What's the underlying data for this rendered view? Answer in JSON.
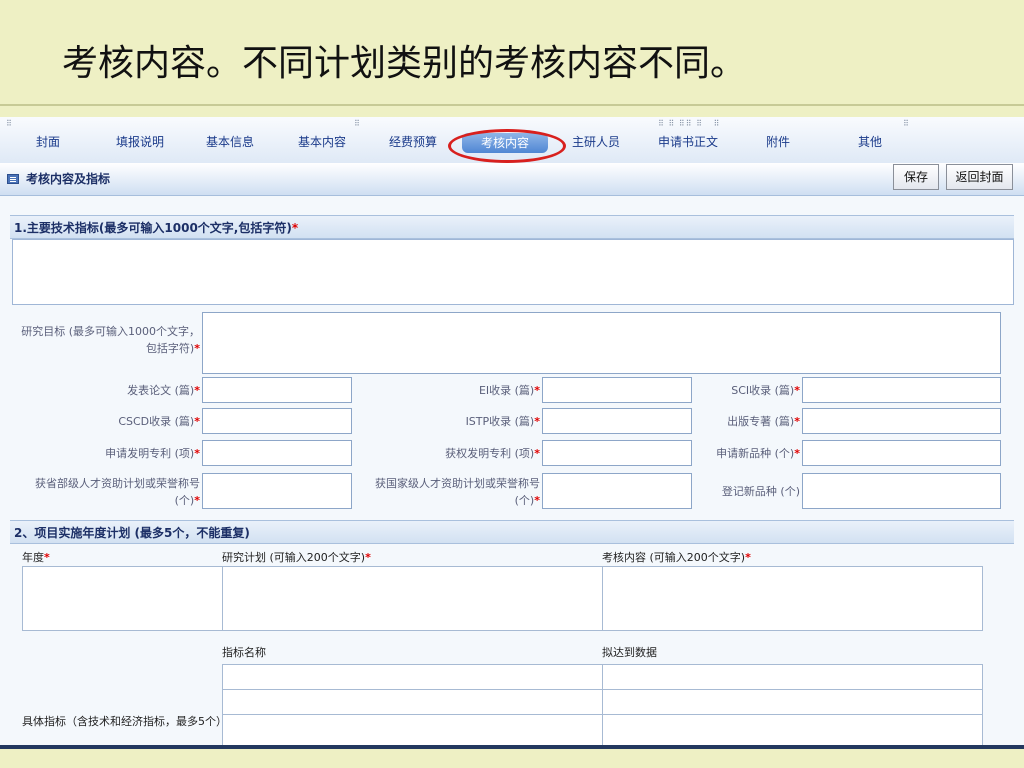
{
  "slide": {
    "title": "考核内容。不同计划类别的考核内容不同。"
  },
  "tabs": [
    {
      "label": "封面"
    },
    {
      "label": "填报说明"
    },
    {
      "label": "基本信息"
    },
    {
      "label": "基本内容"
    },
    {
      "label": "经费预算"
    },
    {
      "label": "考核内容",
      "active": true
    },
    {
      "label": "主研人员"
    },
    {
      "label": "申请书正文"
    },
    {
      "label": "附件"
    },
    {
      "label": "其他"
    }
  ],
  "section": {
    "label": "考核内容及指标",
    "icon": "form-icon",
    "save_label": "保存",
    "back_label": "返回封面"
  },
  "part1": {
    "header": "1.主要技术指标(最多可输入1000个文字,包括字符)",
    "required_mark": "*",
    "goal_label": "研究目标 (最多可输入1000个文字，包括字符)",
    "fields": {
      "papers": "发表论文 (篇)",
      "ei": "EI收录 (篇)",
      "sci": "SCI收录 (篇)",
      "cscd": "CSCD收录 (篇)",
      "istp": "ISTP收录 (篇)",
      "books": "出版专著 (篇)",
      "patent_apply": "申请发明专利 (项)",
      "patent_grant": "获权发明专利 (项)",
      "variety_apply": "申请新品种 (个)",
      "provincial_talent": "获省部级人才资助计划或荣誉称号 (个)",
      "national_talent": "获国家级人才资助计划或荣誉称号 (个)",
      "variety_register": "登记新品种 (个)"
    }
  },
  "part2": {
    "header": "2、项目实施年度计划 (最多5个，不能重复)",
    "col_year": "年度",
    "col_plan": "研究计划 (可输入200个文字)",
    "col_assess": "考核内容 (可输入200个文字)",
    "col_indicator_name": "指标名称",
    "col_target": "拟达到数据",
    "specific_label": "具体指标（含技术和经济指标，最多5个）"
  },
  "colors": {
    "slide_bg": "#eef0c4",
    "highlight_ring": "#d8201e",
    "required": "#e00000",
    "tab_text": "#1a3a8a"
  }
}
